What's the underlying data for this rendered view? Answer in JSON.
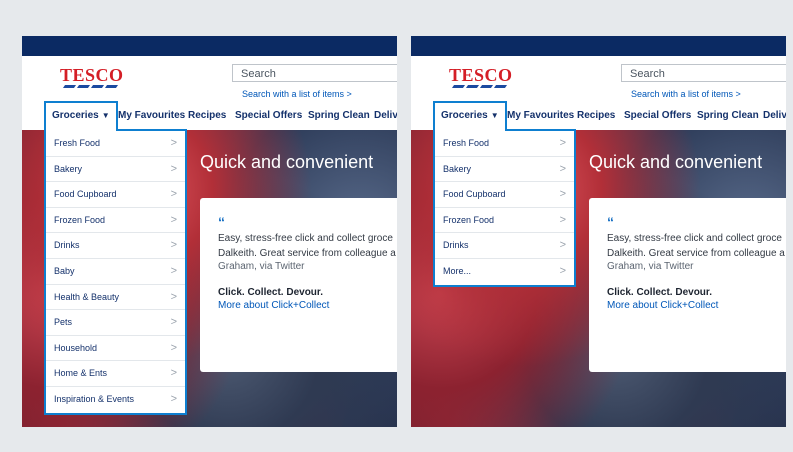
{
  "logo": {
    "text": "TESCO"
  },
  "search": {
    "placeholder": "Search",
    "list_link": "Search with a list of items  >"
  },
  "nav": {
    "groceries": "Groceries",
    "items": [
      "My Favourites",
      "Recipes",
      "Special Offers",
      "Spring Clean",
      "Deliv"
    ]
  },
  "hero": {
    "title": "Quick and convenient",
    "quote_mark": "“",
    "quote_line1": "Easy, stress-free click and collect groce",
    "quote_line2": "Dalkeith. Great service from colleague a",
    "quote_author": "Graham, via Twitter",
    "tagline": "Click. Collect. Devour.",
    "more_link": "More about Click+Collect"
  },
  "left_menu": {
    "items": [
      "Fresh Food",
      "Bakery",
      "Food Cupboard",
      "Frozen Food",
      "Drinks",
      "Baby",
      "Health & Beauty",
      "Pets",
      "Household",
      "Home & Ents",
      "Inspiration & Events"
    ]
  },
  "right_menu": {
    "items": [
      "Fresh Food",
      "Bakery",
      "Food Cupboard",
      "Frozen Food",
      "Drinks",
      "More..."
    ]
  },
  "chevron": ">",
  "colors": {
    "brand_red": "#d41e26",
    "navy": "#0b2a63",
    "nav_blue": "#14316b",
    "link_blue": "#0057b8",
    "focus_blue": "#0e7fd0"
  }
}
